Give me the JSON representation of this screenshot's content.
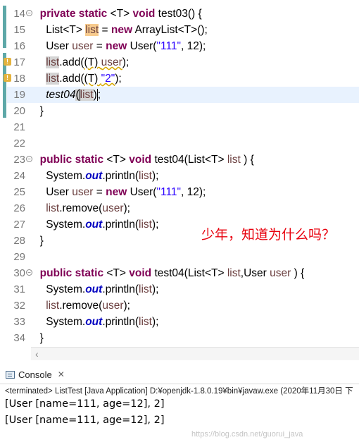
{
  "editor": {
    "lines": [
      {
        "n": "14",
        "fold": true,
        "segs": [
          [
            "kw",
            "private"
          ],
          [
            "",
            ""
          ],
          [
            "kw",
            "static"
          ],
          [
            "",
            ""
          ],
          [
            "",
            "<T> "
          ],
          [
            "kw",
            "void"
          ],
          [
            "",
            " test03() {"
          ]
        ]
      },
      {
        "n": "15",
        "segs": [
          [
            "",
            "List<T> "
          ],
          [
            "hl var",
            "list"
          ],
          [
            "",
            " = "
          ],
          [
            "kw",
            "new"
          ],
          [
            "",
            " ArrayList<T>();"
          ]
        ]
      },
      {
        "n": "16",
        "segs": [
          [
            "",
            "User "
          ],
          [
            "var",
            "user"
          ],
          [
            "",
            " = "
          ],
          [
            "kw",
            "new"
          ],
          [
            "",
            " User("
          ],
          [
            "str",
            "\"111\""
          ],
          [
            "",
            ", 12);"
          ]
        ]
      },
      {
        "n": "17",
        "warn": true,
        "segs": [
          [
            "sel var",
            "list"
          ],
          [
            "",
            ".add("
          ],
          [
            "sq",
            "("
          ],
          [
            "sq",
            "T) "
          ],
          [
            "sq var",
            "user"
          ],
          [
            "",
            ");"
          ]
        ]
      },
      {
        "n": "18",
        "warn": true,
        "segs": [
          [
            "sel var",
            "list"
          ],
          [
            "",
            ".add("
          ],
          [
            "sq",
            "(T) "
          ],
          [
            "sq str",
            "\"2\""
          ],
          [
            "",
            ");"
          ]
        ]
      },
      {
        "n": "19",
        "segs": [
          [
            "it",
            "test04"
          ],
          [
            "sel caret",
            "("
          ],
          [
            "sel var",
            "list"
          ],
          [
            "caret",
            ")"
          ],
          [
            "",
            ";"
          ]
        ]
      },
      {
        "n": "20",
        "segs": [
          [
            "",
            "}"
          ]
        ]
      },
      {
        "n": "21",
        "segs": []
      },
      {
        "n": "22",
        "segs": []
      },
      {
        "n": "23",
        "fold": true,
        "segs": [
          [
            "kw",
            "public"
          ],
          [
            "",
            " "
          ],
          [
            "kw",
            "static"
          ],
          [
            "",
            " <T> "
          ],
          [
            "kw",
            "void"
          ],
          [
            "",
            " test04(List<T> "
          ],
          [
            "var",
            "list"
          ],
          [
            "",
            " ) {"
          ]
        ]
      },
      {
        "n": "24",
        "segs": [
          [
            "",
            "System."
          ],
          [
            "fld",
            "out"
          ],
          [
            "",
            ".println("
          ],
          [
            "var",
            "list"
          ],
          [
            ");",
            ""
          ]
        ]
      },
      {
        "n": "25",
        "segs": [
          [
            "",
            "User "
          ],
          [
            "var",
            "user"
          ],
          [
            "",
            " = "
          ],
          [
            "kw",
            "new"
          ],
          [
            "",
            " User("
          ],
          [
            "str",
            "\"111\""
          ],
          [
            "",
            ", 12);"
          ]
        ]
      },
      {
        "n": "26",
        "segs": [
          [
            "var",
            "list"
          ],
          [
            "",
            ".remove("
          ],
          [
            "var",
            "user"
          ],
          [
            "",
            ");"
          ]
        ]
      },
      {
        "n": "27",
        "segs": [
          [
            "",
            "System."
          ],
          [
            "fld",
            "out"
          ],
          [
            "",
            ".println("
          ],
          [
            "var",
            "list"
          ],
          [
            "",
            ");"
          ]
        ]
      },
      {
        "n": "28",
        "segs": [
          [
            "",
            "}"
          ]
        ]
      },
      {
        "n": "29",
        "segs": []
      },
      {
        "n": "30",
        "fold": true,
        "segs": [
          [
            "kw",
            "public"
          ],
          [
            "",
            " "
          ],
          [
            "kw",
            "static"
          ],
          [
            "",
            " <T> "
          ],
          [
            "kw",
            "void"
          ],
          [
            "",
            " test04(List<T> "
          ],
          [
            "var",
            "list"
          ],
          [
            "",
            ",User "
          ],
          [
            "var",
            "user"
          ],
          [
            "",
            " ) {"
          ]
        ]
      },
      {
        "n": "31",
        "segs": [
          [
            "",
            "System."
          ],
          [
            "fld",
            "out"
          ],
          [
            "",
            ".println("
          ],
          [
            "var",
            "list"
          ],
          [
            "",
            ");"
          ]
        ]
      },
      {
        "n": "32",
        "segs": [
          [
            "var",
            "list"
          ],
          [
            "",
            ".remove("
          ],
          [
            "var",
            "user"
          ],
          [
            "",
            ");"
          ]
        ]
      },
      {
        "n": "33",
        "segs": [
          [
            "",
            "System."
          ],
          [
            "fld",
            "out"
          ],
          [
            "",
            ".println("
          ],
          [
            "var",
            "list"
          ],
          [
            "",
            ");"
          ]
        ]
      },
      {
        "n": "34",
        "segs": [
          [
            "",
            "}"
          ]
        ]
      }
    ],
    "annotation": "少年，知道为什么吗？"
  },
  "console": {
    "tab_label": "Console",
    "status": "<terminated> ListTest [Java Application] D:¥openjdk-1.8.0.19¥bin¥javaw.exe (2020年11月30日 下",
    "output": [
      "[User [name=111, age=12], 2]",
      "[User [name=111, age=12], 2]"
    ]
  },
  "watermark": "https://blog.csdn.net/guorui_java",
  "colors": {
    "keyword": "#7f0055",
    "field": "#0000c0",
    "string": "#2a00ff",
    "annotation": "#e8000d",
    "overview": "#5ea8a8"
  }
}
